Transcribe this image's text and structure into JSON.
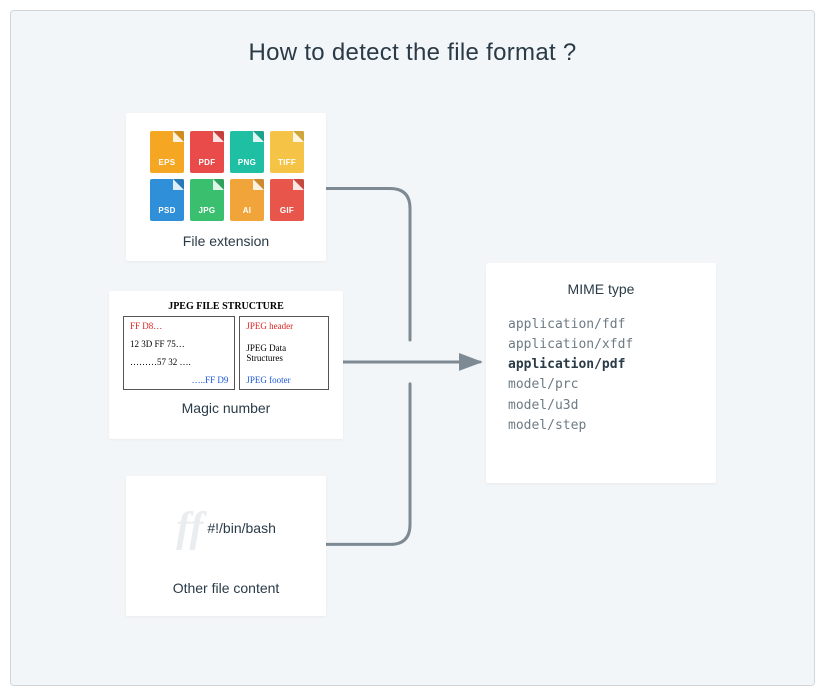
{
  "title": "How to detect the file format ?",
  "left": {
    "extension": {
      "label": "File extension",
      "icons": [
        {
          "name": "EPS",
          "color": "c-orange"
        },
        {
          "name": "PDF",
          "color": "c-red"
        },
        {
          "name": "PNG",
          "color": "c-teal"
        },
        {
          "name": "TIFF",
          "color": "c-yellow"
        },
        {
          "name": "PSD",
          "color": "c-blue"
        },
        {
          "name": "JPG",
          "color": "c-green"
        },
        {
          "name": "AI",
          "color": "c-gold"
        },
        {
          "name": "GIF",
          "color": "c-red2"
        }
      ]
    },
    "magic": {
      "label": "Magic number",
      "heading": "JPEG FILE STRUCTURE",
      "left_lines": [
        "FF D8…",
        "12 3D FF 75…",
        "………57 32 ….",
        "…..FF D9"
      ],
      "right_lines": [
        "JPEG header",
        "JPEG Data Structures",
        "JPEG footer"
      ]
    },
    "other": {
      "label": "Other file content",
      "ghost": "ff",
      "shebang": "#!/bin/bash"
    }
  },
  "mime": {
    "title": "MIME type",
    "items": [
      {
        "text": "application/fdf",
        "bold": false
      },
      {
        "text": "application/xfdf",
        "bold": false
      },
      {
        "text": "application/pdf",
        "bold": true
      },
      {
        "text": "model/prc",
        "bold": false
      },
      {
        "text": "model/u3d",
        "bold": false
      },
      {
        "text": "model/step",
        "bold": false
      }
    ]
  }
}
